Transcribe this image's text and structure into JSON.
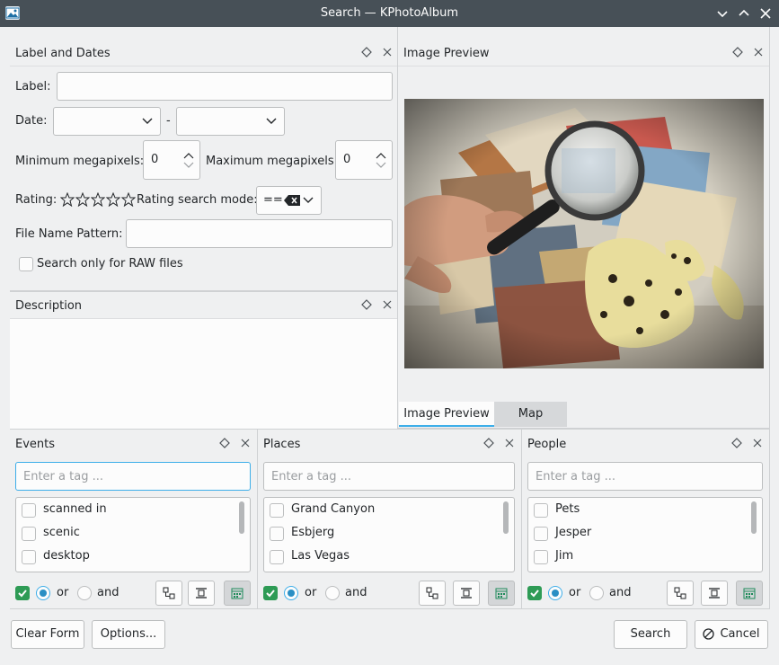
{
  "window": {
    "title": "Search — KPhotoAlbum"
  },
  "label_dates": {
    "title": "Label and Dates",
    "label_label": "Label:",
    "label_value": "",
    "date_label": "Date:",
    "date_separator": "-",
    "date_from": "",
    "date_to": "",
    "min_mp_label": "Minimum megapixels:",
    "min_mp_value": "0",
    "max_mp_label": "Maximum megapixels:",
    "max_mp_value": "0",
    "rating_label": "Rating:",
    "rating_value": 0,
    "rating_max": 5,
    "rating_mode_label": "Rating search mode:",
    "rating_mode_value": "==",
    "filename_label": "File Name Pattern:",
    "filename_value": "",
    "raw_label": "Search only for RAW files",
    "raw_checked": false
  },
  "description": {
    "title": "Description",
    "value": ""
  },
  "image_preview": {
    "title": "Image Preview",
    "tabs": [
      {
        "label": "Image Preview",
        "active": true
      },
      {
        "label": "Map",
        "active": false
      }
    ]
  },
  "categories": [
    {
      "title": "Events",
      "placeholder": "Enter a tag ...",
      "items": [
        "scanned in",
        "scenic",
        "desktop"
      ],
      "or_label": "or",
      "and_label": "and",
      "mode": "or"
    },
    {
      "title": "Places",
      "placeholder": "Enter a tag ...",
      "items": [
        "Grand Canyon",
        "Esbjerg",
        "Las Vegas"
      ],
      "or_label": "or",
      "and_label": "and",
      "mode": "or"
    },
    {
      "title": "People",
      "placeholder": "Enter a tag ...",
      "items": [
        "Pets",
        "Jesper",
        "Jim"
      ],
      "or_label": "or",
      "and_label": "and",
      "mode": "or"
    }
  ],
  "buttons": {
    "clear_form": "Clear Form",
    "options": "Options...",
    "search": "Search",
    "cancel": "Cancel"
  },
  "colors": {
    "titlebar": "#475057",
    "accent": "#3daee9",
    "check_green": "#2e9b55",
    "window_bg": "#eff0f1"
  }
}
